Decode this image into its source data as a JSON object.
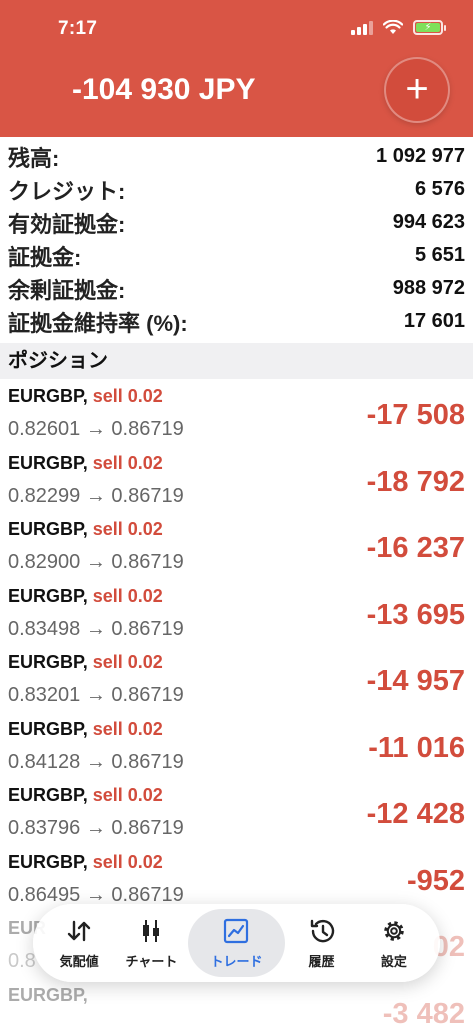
{
  "status": {
    "time": "7:17"
  },
  "header": {
    "total": "-104 930 JPY",
    "add_label": "+"
  },
  "summary": [
    {
      "label": "残高:",
      "value": "1 092 977"
    },
    {
      "label": "クレジット:",
      "value": "6 576"
    },
    {
      "label": "有効証拠金:",
      "value": "994 623"
    },
    {
      "label": "証拠金:",
      "value": "5 651"
    },
    {
      "label": "余剰証拠金:",
      "value": "988 972"
    },
    {
      "label": "証拠金維持率 (%):",
      "value": "17 601"
    }
  ],
  "positions_title": "ポジション",
  "positions": [
    {
      "symbol": "EURGBP,",
      "side": "sell 0.02",
      "prices": "0.82601 → 0.86719",
      "profit": "-17 508"
    },
    {
      "symbol": "EURGBP,",
      "side": "sell 0.02",
      "prices": "0.82299 → 0.86719",
      "profit": "-18 792"
    },
    {
      "symbol": "EURGBP,",
      "side": "sell 0.02",
      "prices": "0.82900 → 0.86719",
      "profit": "-16 237"
    },
    {
      "symbol": "EURGBP,",
      "side": "sell 0.02",
      "prices": "0.83498 → 0.86719",
      "profit": "-13 695"
    },
    {
      "symbol": "EURGBP,",
      "side": "sell 0.02",
      "prices": "0.83201 → 0.86719",
      "profit": "-14 957"
    },
    {
      "symbol": "EURGBP,",
      "side": "sell 0.02",
      "prices": "0.84128 → 0.86719",
      "profit": "-11 016"
    },
    {
      "symbol": "EURGBP,",
      "side": "sell 0.02",
      "prices": "0.83796 → 0.86719",
      "profit": "-12 428"
    },
    {
      "symbol": "EURGBP,",
      "side": "sell 0.02",
      "prices": "0.86495 → 0.86719",
      "profit": "-952"
    },
    {
      "symbol": "EUR",
      "side": "",
      "prices": "0.8",
      "profit": "02"
    },
    {
      "symbol": "EURGBP,",
      "side": "",
      "prices": "",
      "profit": "-3 482"
    }
  ],
  "tabs": [
    {
      "label": "気配値",
      "icon": "arrows-updown-icon"
    },
    {
      "label": "チャート",
      "icon": "candlestick-icon"
    },
    {
      "label": "トレード",
      "icon": "trade-chart-icon"
    },
    {
      "label": "履歴",
      "icon": "history-icon"
    },
    {
      "label": "設定",
      "icon": "gear-icon"
    }
  ],
  "colors": {
    "header": "#d95545",
    "loss": "#d24c3c",
    "active_tab": "#2f6fe0"
  }
}
